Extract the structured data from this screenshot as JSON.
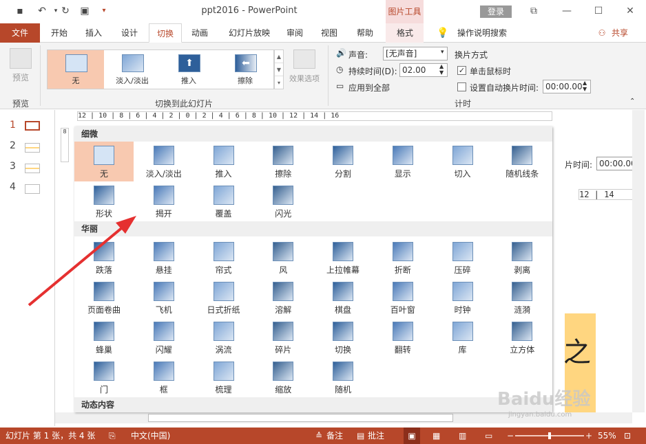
{
  "titlebar": {
    "title": "ppt2016  -  PowerPoint",
    "picture_tools": "图片工具",
    "login": "登录",
    "undo_icon": "undo-icon",
    "save_icon": "save-icon"
  },
  "tabs": [
    "文件",
    "开始",
    "插入",
    "设计",
    "切换",
    "动画",
    "幻灯片放映",
    "审阅",
    "视图",
    "帮助",
    "格式"
  ],
  "search_hint": "操作说明搜索",
  "share": "共享",
  "ribbon": {
    "preview_label": "预览",
    "preview_group": "预览",
    "gallery": [
      "无",
      "淡入/淡出",
      "推入",
      "擦除"
    ],
    "effects": "效果选项",
    "gallery_group": "切换到此幻灯片",
    "sound_label": "声音:",
    "sound_value": "[无声音]",
    "duration_label": "持续时间(D):",
    "duration_value": "02.00",
    "apply_all": "应用到全部",
    "advance_title": "换片方式",
    "on_click": "单击鼠标时",
    "auto_after": "设置自动换片时间:",
    "auto_value": "00:00.00",
    "timing_group": "计时"
  },
  "slides": [
    "1",
    "2",
    "3",
    "4"
  ],
  "ruler": "12 | 10 | 8 | 6 | 4 | 2 | 0 | 2 | 4 | 6 | 8 | 10 | 12 | 14 | 16",
  "slide_behind": {
    "label": "片时间:",
    "value": "00:00.00",
    "ruler": "12 | 14",
    "char": "之"
  },
  "panel": {
    "sections": [
      "细微",
      "华丽",
      "动态内容"
    ],
    "subtle": [
      "无",
      "淡入/淡出",
      "推入",
      "擦除",
      "分割",
      "显示",
      "切入",
      "随机线条",
      "形状",
      "揭开",
      "覆盖",
      "闪光"
    ],
    "exciting": [
      "跌落",
      "悬挂",
      "帘式",
      "风",
      "上拉帷幕",
      "折断",
      "压碎",
      "剥离",
      "页面卷曲",
      "飞机",
      "日式折纸",
      "溶解",
      "棋盘",
      "百叶窗",
      "时钟",
      "涟漪",
      "蜂巢",
      "闪耀",
      "涡流",
      "碎片",
      "切换",
      "翻转",
      "库",
      "立方体",
      "门",
      "框",
      "梳理",
      "缩放",
      "随机"
    ]
  },
  "status": {
    "slide": "幻灯片 第 1 张，共 4 张",
    "lang": "中文(中国)",
    "notes": "备注",
    "comments": "批注",
    "zoom": "55%"
  },
  "watermark": "Baidu经验",
  "watermark_url": "jingyan.baidu.com",
  "colors": {
    "accent": "#b7472a",
    "selected": "#f8c9b0"
  }
}
